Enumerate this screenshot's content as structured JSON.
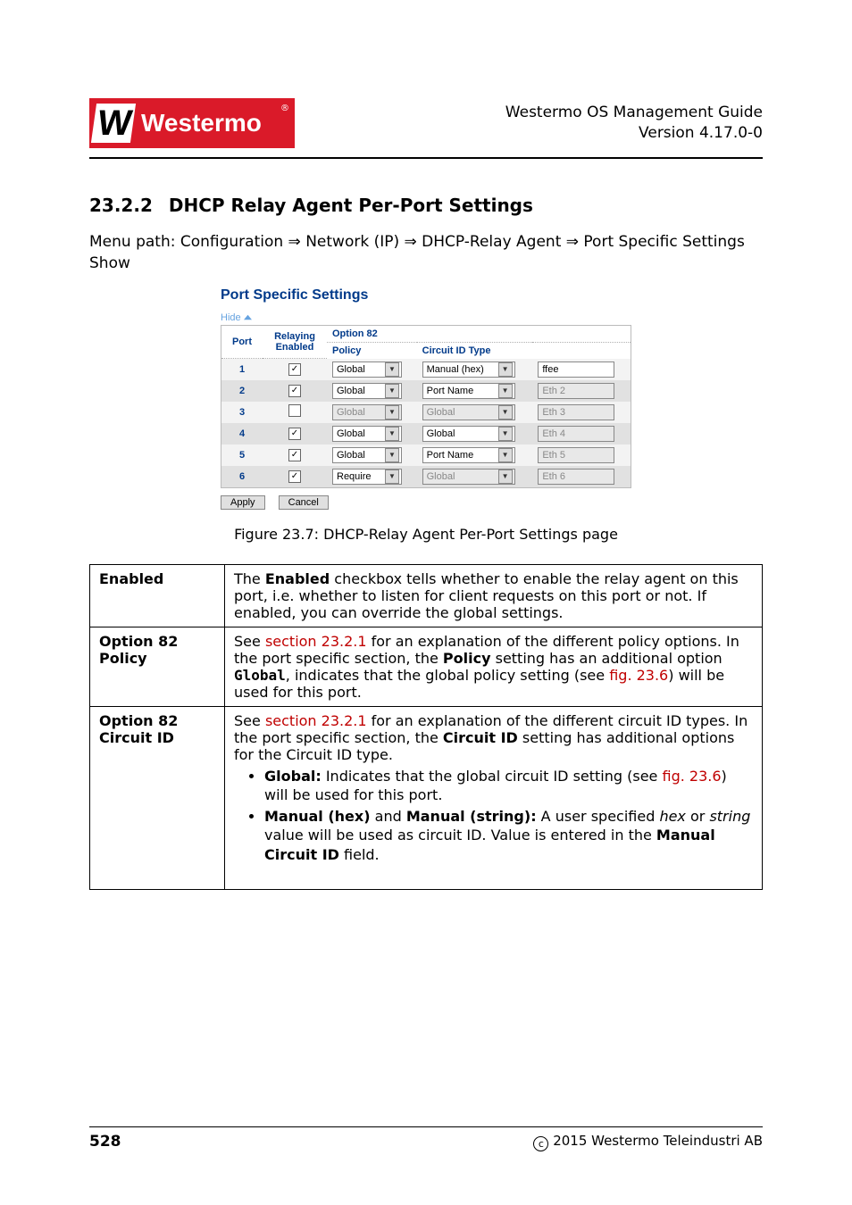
{
  "header": {
    "logo_text": "Westermo",
    "guide_title": "Westermo OS Management Guide",
    "version": "Version 4.17.0-0"
  },
  "section": {
    "number": "23.2.2",
    "title": "DHCP Relay Agent Per-Port Settings"
  },
  "menu_path": "Menu path: Configuration ⇒ Network (IP) ⇒ DHCP-Relay Agent ⇒ Port Specific Settings Show",
  "figure": {
    "panel_title": "Port Specific Settings",
    "hide_label": "Hide",
    "headers": {
      "port": "Port",
      "relaying": "Relaying Enabled",
      "option82": "Option 82",
      "policy": "Policy",
      "circuit_id_type": "Circuit ID Type"
    },
    "rows": [
      {
        "port": "1",
        "enabled": true,
        "policy": "Global",
        "circuit": "Manual (hex)",
        "value": "ffee",
        "circuit_disabled": false,
        "value_disabled": false
      },
      {
        "port": "2",
        "enabled": true,
        "policy": "Global",
        "circuit": "Port Name",
        "value": "Eth 2",
        "circuit_disabled": false,
        "value_disabled": true
      },
      {
        "port": "3",
        "enabled": false,
        "policy": "Global",
        "circuit": "Global",
        "value": "Eth 3",
        "circuit_disabled": true,
        "value_disabled": true
      },
      {
        "port": "4",
        "enabled": true,
        "policy": "Global",
        "circuit": "Global",
        "value": "Eth 4",
        "circuit_disabled": false,
        "value_disabled": true
      },
      {
        "port": "5",
        "enabled": true,
        "policy": "Global",
        "circuit": "Port Name",
        "value": "Eth 5",
        "circuit_disabled": false,
        "value_disabled": true
      },
      {
        "port": "6",
        "enabled": true,
        "policy": "Require",
        "circuit": "Global",
        "value": "Eth 6",
        "circuit_disabled": true,
        "value_disabled": true
      }
    ],
    "apply": "Apply",
    "cancel": "Cancel",
    "caption": "Figure 23.7: DHCP-Relay Agent Per-Port Settings page"
  },
  "desc": {
    "row1_label": "Enabled",
    "row1_t1": "The ",
    "row1_b1": "Enabled",
    "row1_t2": " checkbox tells whether to enable the relay agent on this port, i.e. whether to listen for client requests on this port or not. If enabled, you can override the global settings.",
    "row2_label1": "Option 82",
    "row2_label2": "Policy",
    "row2_t1": "See ",
    "row2_link1": "section 23.2.1",
    "row2_t2": " for an explanation of the different policy options. In the port specific section, the ",
    "row2_b1": "Policy",
    "row2_t3": " setting has an additional option ",
    "row2_m1": "Global",
    "row2_t4": ", indicates that the global policy setting (see ",
    "row2_link2": "fig. 23.6",
    "row2_t5": ") will be used for this port.",
    "row3_label1": "Option 82",
    "row3_label2": "Circuit ID",
    "row3_t1": "See ",
    "row3_link1": "section 23.2.1",
    "row3_t2": " for an explanation of the different circuit ID types. In the port specific section, the ",
    "row3_b1": "Circuit ID",
    "row3_t3": " setting has additional options for the Circuit ID type.",
    "row3_li1_b": "Global:",
    "row3_li1_t1": " Indicates that the global circuit ID setting (see ",
    "row3_li1_link": "fig. 23.6",
    "row3_li1_t2": ") will be used for this port.",
    "row3_li2_b1": "Manual (hex)",
    "row3_li2_t1": " and ",
    "row3_li2_b2": "Manual (string):",
    "row3_li2_t2": " A user specified ",
    "row3_li2_i1": "hex",
    "row3_li2_t3": " or ",
    "row3_li2_i2": "string",
    "row3_li2_t4": " value will be used as circuit ID. Value is entered in the ",
    "row3_li2_b3": "Manual Circuit ID",
    "row3_li2_t5": " field."
  },
  "footer": {
    "page": "528",
    "copyright": "2015 Westermo Teleindustri AB"
  }
}
